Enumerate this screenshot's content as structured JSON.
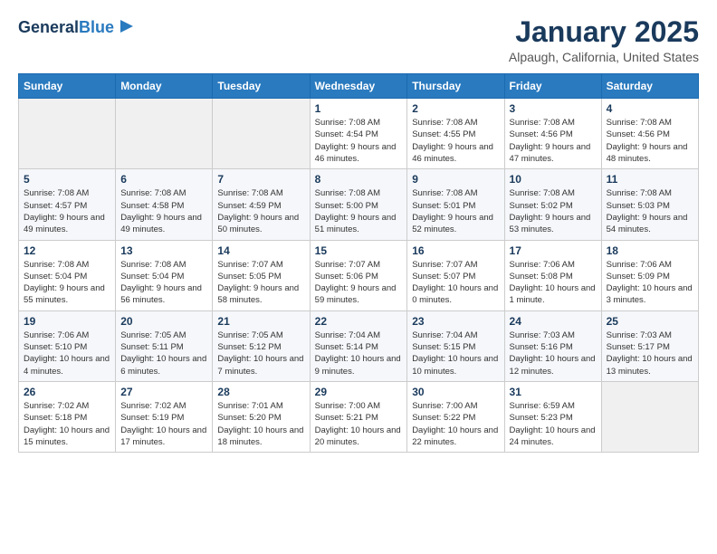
{
  "header": {
    "logo_line1": "General",
    "logo_line2": "Blue",
    "month": "January 2025",
    "location": "Alpaugh, California, United States"
  },
  "weekdays": [
    "Sunday",
    "Monday",
    "Tuesday",
    "Wednesday",
    "Thursday",
    "Friday",
    "Saturday"
  ],
  "weeks": [
    [
      {
        "day": "",
        "info": ""
      },
      {
        "day": "",
        "info": ""
      },
      {
        "day": "",
        "info": ""
      },
      {
        "day": "1",
        "info": "Sunrise: 7:08 AM\nSunset: 4:54 PM\nDaylight: 9 hours and 46 minutes."
      },
      {
        "day": "2",
        "info": "Sunrise: 7:08 AM\nSunset: 4:55 PM\nDaylight: 9 hours and 46 minutes."
      },
      {
        "day": "3",
        "info": "Sunrise: 7:08 AM\nSunset: 4:56 PM\nDaylight: 9 hours and 47 minutes."
      },
      {
        "day": "4",
        "info": "Sunrise: 7:08 AM\nSunset: 4:56 PM\nDaylight: 9 hours and 48 minutes."
      }
    ],
    [
      {
        "day": "5",
        "info": "Sunrise: 7:08 AM\nSunset: 4:57 PM\nDaylight: 9 hours and 49 minutes."
      },
      {
        "day": "6",
        "info": "Sunrise: 7:08 AM\nSunset: 4:58 PM\nDaylight: 9 hours and 49 minutes."
      },
      {
        "day": "7",
        "info": "Sunrise: 7:08 AM\nSunset: 4:59 PM\nDaylight: 9 hours and 50 minutes."
      },
      {
        "day": "8",
        "info": "Sunrise: 7:08 AM\nSunset: 5:00 PM\nDaylight: 9 hours and 51 minutes."
      },
      {
        "day": "9",
        "info": "Sunrise: 7:08 AM\nSunset: 5:01 PM\nDaylight: 9 hours and 52 minutes."
      },
      {
        "day": "10",
        "info": "Sunrise: 7:08 AM\nSunset: 5:02 PM\nDaylight: 9 hours and 53 minutes."
      },
      {
        "day": "11",
        "info": "Sunrise: 7:08 AM\nSunset: 5:03 PM\nDaylight: 9 hours and 54 minutes."
      }
    ],
    [
      {
        "day": "12",
        "info": "Sunrise: 7:08 AM\nSunset: 5:04 PM\nDaylight: 9 hours and 55 minutes."
      },
      {
        "day": "13",
        "info": "Sunrise: 7:08 AM\nSunset: 5:04 PM\nDaylight: 9 hours and 56 minutes."
      },
      {
        "day": "14",
        "info": "Sunrise: 7:07 AM\nSunset: 5:05 PM\nDaylight: 9 hours and 58 minutes."
      },
      {
        "day": "15",
        "info": "Sunrise: 7:07 AM\nSunset: 5:06 PM\nDaylight: 9 hours and 59 minutes."
      },
      {
        "day": "16",
        "info": "Sunrise: 7:07 AM\nSunset: 5:07 PM\nDaylight: 10 hours and 0 minutes."
      },
      {
        "day": "17",
        "info": "Sunrise: 7:06 AM\nSunset: 5:08 PM\nDaylight: 10 hours and 1 minute."
      },
      {
        "day": "18",
        "info": "Sunrise: 7:06 AM\nSunset: 5:09 PM\nDaylight: 10 hours and 3 minutes."
      }
    ],
    [
      {
        "day": "19",
        "info": "Sunrise: 7:06 AM\nSunset: 5:10 PM\nDaylight: 10 hours and 4 minutes."
      },
      {
        "day": "20",
        "info": "Sunrise: 7:05 AM\nSunset: 5:11 PM\nDaylight: 10 hours and 6 minutes."
      },
      {
        "day": "21",
        "info": "Sunrise: 7:05 AM\nSunset: 5:12 PM\nDaylight: 10 hours and 7 minutes."
      },
      {
        "day": "22",
        "info": "Sunrise: 7:04 AM\nSunset: 5:14 PM\nDaylight: 10 hours and 9 minutes."
      },
      {
        "day": "23",
        "info": "Sunrise: 7:04 AM\nSunset: 5:15 PM\nDaylight: 10 hours and 10 minutes."
      },
      {
        "day": "24",
        "info": "Sunrise: 7:03 AM\nSunset: 5:16 PM\nDaylight: 10 hours and 12 minutes."
      },
      {
        "day": "25",
        "info": "Sunrise: 7:03 AM\nSunset: 5:17 PM\nDaylight: 10 hours and 13 minutes."
      }
    ],
    [
      {
        "day": "26",
        "info": "Sunrise: 7:02 AM\nSunset: 5:18 PM\nDaylight: 10 hours and 15 minutes."
      },
      {
        "day": "27",
        "info": "Sunrise: 7:02 AM\nSunset: 5:19 PM\nDaylight: 10 hours and 17 minutes."
      },
      {
        "day": "28",
        "info": "Sunrise: 7:01 AM\nSunset: 5:20 PM\nDaylight: 10 hours and 18 minutes."
      },
      {
        "day": "29",
        "info": "Sunrise: 7:00 AM\nSunset: 5:21 PM\nDaylight: 10 hours and 20 minutes."
      },
      {
        "day": "30",
        "info": "Sunrise: 7:00 AM\nSunset: 5:22 PM\nDaylight: 10 hours and 22 minutes."
      },
      {
        "day": "31",
        "info": "Sunrise: 6:59 AM\nSunset: 5:23 PM\nDaylight: 10 hours and 24 minutes."
      },
      {
        "day": "",
        "info": ""
      }
    ]
  ]
}
